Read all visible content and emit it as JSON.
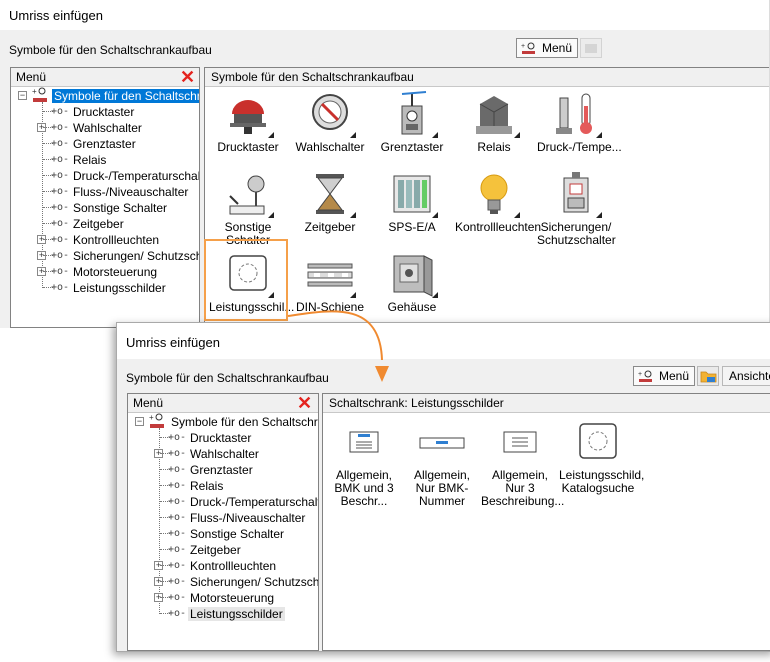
{
  "dialog_top": {
    "title": "Umriss einfügen",
    "subtitle": "Symbole für den Schaltschrankaufbau",
    "menu_button": "Menü",
    "left_panel": {
      "title": "Menü",
      "tree": [
        {
          "label": "Symbole für den Schaltschrankaufbau",
          "level": 0,
          "expander": "⊟",
          "selected": true
        },
        {
          "label": "Drucktaster",
          "level": 1,
          "expander": ""
        },
        {
          "label": "Wahlschalter",
          "level": 1,
          "expander": "⊞"
        },
        {
          "label": "Grenztaster",
          "level": 1,
          "expander": ""
        },
        {
          "label": "Relais",
          "level": 1,
          "expander": ""
        },
        {
          "label": "Druck-/Temperaturschalter",
          "level": 1,
          "expander": ""
        },
        {
          "label": "Fluss-/Niveauschalter",
          "level": 1,
          "expander": ""
        },
        {
          "label": "Sonstige Schalter",
          "level": 1,
          "expander": ""
        },
        {
          "label": "Zeitgeber",
          "level": 1,
          "expander": ""
        },
        {
          "label": "Kontrollleuchten",
          "level": 1,
          "expander": "⊞"
        },
        {
          "label": "Sicherungen/ Schutzschalter",
          "level": 1,
          "expander": "⊞"
        },
        {
          "label": "Motorsteuerung",
          "level": 1,
          "expander": "⊞"
        },
        {
          "label": "Leistungsschilder",
          "level": 1,
          "expander": ""
        }
      ]
    },
    "right_panel": {
      "title": "Symbole für den Schaltschrankaufbau",
      "items": [
        {
          "label": "Drucktaster",
          "icon": "push-button-icon"
        },
        {
          "label": "Wahlschalter",
          "icon": "selector-switch-icon"
        },
        {
          "label": "Grenztaster",
          "icon": "limit-switch-icon"
        },
        {
          "label": "Relais",
          "icon": "relay-icon"
        },
        {
          "label": "Druck-/Tempe...",
          "icon": "pressure-temperature-icon"
        },
        {
          "label": "Sonstige Schalter",
          "icon": "other-switch-icon"
        },
        {
          "label": "Zeitgeber",
          "icon": "timer-hourglass-icon"
        },
        {
          "label": "SPS-E/A",
          "icon": "plc-io-icon"
        },
        {
          "label": "Kontrollleuchten",
          "icon": "pilot-light-bulb-icon"
        },
        {
          "label": "Sicherungen/ Schutzschalter",
          "icon": "fuse-breaker-icon"
        },
        {
          "label": "Leistungsschil...",
          "icon": "nameplate-icon"
        },
        {
          "label": "DIN-Schiene",
          "icon": "din-rail-icon"
        },
        {
          "label": "Gehäuse",
          "icon": "enclosure-icon"
        }
      ]
    }
  },
  "dialog_bottom": {
    "title": "Umriss einfügen",
    "subtitle": "Symbole für den Schaltschrankaufbau",
    "menu_button": "Menü",
    "view_button": "Ansichte",
    "left_panel": {
      "title": "Menü",
      "tree": [
        {
          "label": "Symbole für den Schaltschrankaufbau",
          "level": 0,
          "expander": "⊟",
          "selected": false
        },
        {
          "label": "Drucktaster",
          "level": 1,
          "expander": ""
        },
        {
          "label": "Wahlschalter",
          "level": 1,
          "expander": "⊞"
        },
        {
          "label": "Grenztaster",
          "level": 1,
          "expander": ""
        },
        {
          "label": "Relais",
          "level": 1,
          "expander": ""
        },
        {
          "label": "Druck-/Temperaturschalter",
          "level": 1,
          "expander": ""
        },
        {
          "label": "Fluss-/Niveauschalter",
          "level": 1,
          "expander": ""
        },
        {
          "label": "Sonstige Schalter",
          "level": 1,
          "expander": ""
        },
        {
          "label": "Zeitgeber",
          "level": 1,
          "expander": ""
        },
        {
          "label": "Kontrollleuchten",
          "level": 1,
          "expander": "⊞"
        },
        {
          "label": "Sicherungen/ Schutzschalter",
          "level": 1,
          "expander": "⊞"
        },
        {
          "label": "Motorsteuerung",
          "level": 1,
          "expander": "⊞"
        },
        {
          "label": "Leistungsschilder",
          "level": 1,
          "expander": "",
          "highlighted": true
        }
      ]
    },
    "right_panel": {
      "title": "Schaltschrank: Leistungsschilder",
      "items": [
        {
          "label": "Allgemein, BMK und 3 Beschr...",
          "icon": "nameplate-bmk-3-icon"
        },
        {
          "label": "Allgemein, Nur BMK-Nummer",
          "icon": "nameplate-bmk-only-icon"
        },
        {
          "label": "Allgemein, Nur 3 Beschreibung...",
          "icon": "nameplate-3-desc-icon"
        },
        {
          "label": "Leistungsschild, Katalogsuche",
          "icon": "nameplate-catalog-icon"
        }
      ]
    }
  },
  "colors": {
    "selection": "#0078d7",
    "close_x": "#e4231e",
    "highlight_box": "#f5a04a"
  }
}
